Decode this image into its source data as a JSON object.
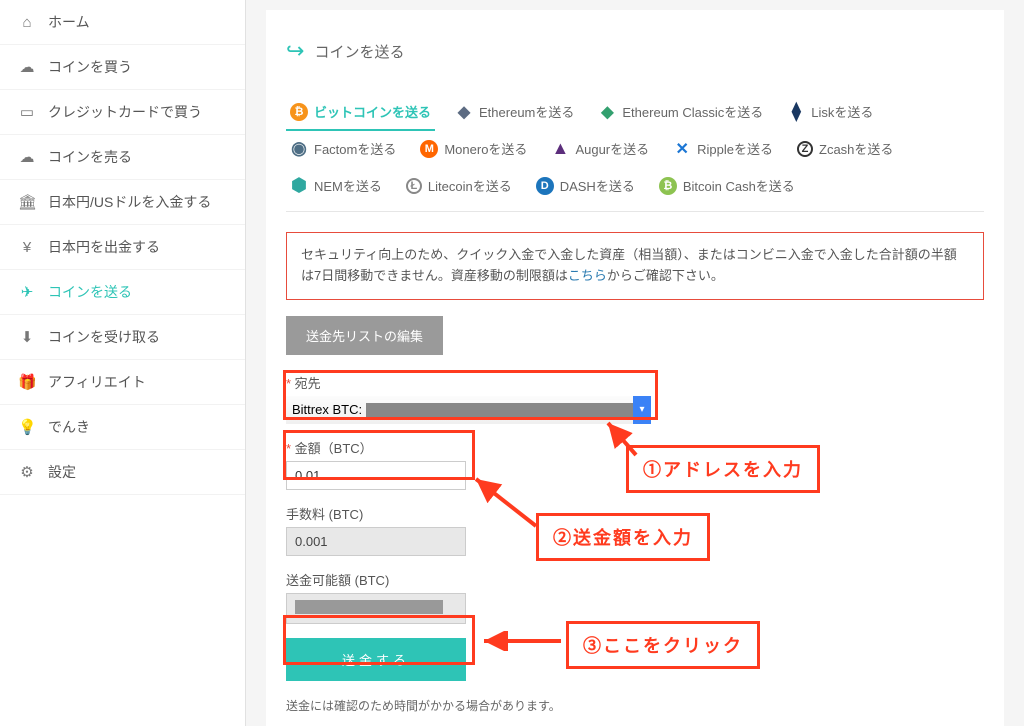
{
  "sidebar": {
    "items": [
      {
        "icon": "home-icon",
        "glyph": "⌂",
        "label": "ホーム"
      },
      {
        "icon": "cloud-down-icon",
        "glyph": "☁",
        "label": "コインを買う"
      },
      {
        "icon": "card-icon",
        "glyph": "▭",
        "label": "クレジットカードで買う"
      },
      {
        "icon": "cloud-up-icon",
        "glyph": "☁",
        "label": "コインを売る"
      },
      {
        "icon": "bank-icon",
        "glyph": "🏛",
        "label": "日本円/USドルを入金する"
      },
      {
        "icon": "yen-icon",
        "glyph": "¥",
        "label": "日本円を出金する"
      },
      {
        "icon": "send-icon",
        "glyph": "✈",
        "label": "コインを送る",
        "active": true
      },
      {
        "icon": "download-icon",
        "glyph": "⬇",
        "label": "コインを受け取る"
      },
      {
        "icon": "gift-icon",
        "glyph": "🎁",
        "label": "アフィリエイト"
      },
      {
        "icon": "bulb-icon",
        "glyph": "💡",
        "label": "でんき"
      },
      {
        "icon": "gear-icon",
        "glyph": "⚙",
        "label": "設定"
      }
    ]
  },
  "page": {
    "title": "コインを送る"
  },
  "tabs": [
    {
      "name": "bitcoin",
      "label": "ビットコインを送る",
      "icon_class": "btc",
      "glyph": "₿",
      "active": true
    },
    {
      "name": "ethereum",
      "label": "Ethereumを送る",
      "icon_class": "eth-d",
      "glyph": "◆"
    },
    {
      "name": "ethereum-classic",
      "label": "Ethereum Classicを送る",
      "icon_class": "etc-d",
      "glyph": "◆"
    },
    {
      "name": "lisk",
      "label": "Liskを送る",
      "icon_class": "lisk-d",
      "glyph": "⧫"
    },
    {
      "name": "factom",
      "label": "Factomを送る",
      "icon_class": "fct-d",
      "glyph": "◉"
    },
    {
      "name": "monero",
      "label": "Moneroを送る",
      "icon_class": "xmr",
      "glyph": "M"
    },
    {
      "name": "augur",
      "label": "Augurを送る",
      "icon_class": "rep-d",
      "glyph": "▲"
    },
    {
      "name": "ripple",
      "label": "Rippleを送る",
      "icon_class": "xrp-d",
      "glyph": "✕"
    },
    {
      "name": "zcash",
      "label": "Zcashを送る",
      "icon_class": "zec-d",
      "glyph": "Z"
    },
    {
      "name": "nem",
      "label": "NEMを送る",
      "icon_class": "xem-d",
      "glyph": "⬢"
    },
    {
      "name": "litecoin",
      "label": "Litecoinを送る",
      "icon_class": "ltc-d",
      "glyph": "Ł"
    },
    {
      "name": "dash",
      "label": "DASHを送る",
      "icon_class": "dash",
      "glyph": "D"
    },
    {
      "name": "bitcoin-cash",
      "label": "Bitcoin Cashを送る",
      "icon_class": "bch",
      "glyph": "₿"
    }
  ],
  "notice": {
    "text_a": "セキュリティ向上のため、クイック入金で入金した資産（相当額）、またはコンビニ入金で入金した合計額の半額は7日間移動できません。資産移動の制限額は",
    "link": "こちら",
    "text_b": "からご確認下さい。"
  },
  "buttons": {
    "edit_list": "送金先リストの編集",
    "submit": "送金する"
  },
  "form": {
    "addr_label": "宛先",
    "addr_value_prefix": "Bittrex BTC:",
    "amount_label": "金額（BTC）",
    "amount_value": "0.01",
    "fee_label": "手数料 (BTC)",
    "fee_value": "0.001",
    "avail_label": "送金可能額 (BTC)"
  },
  "footnote": "送金には確認のため時間がかかる場合があります。",
  "annotations": {
    "a1": "①アドレスを入力",
    "a2": "②送金額を入力",
    "a3": "③ここをクリック"
  }
}
